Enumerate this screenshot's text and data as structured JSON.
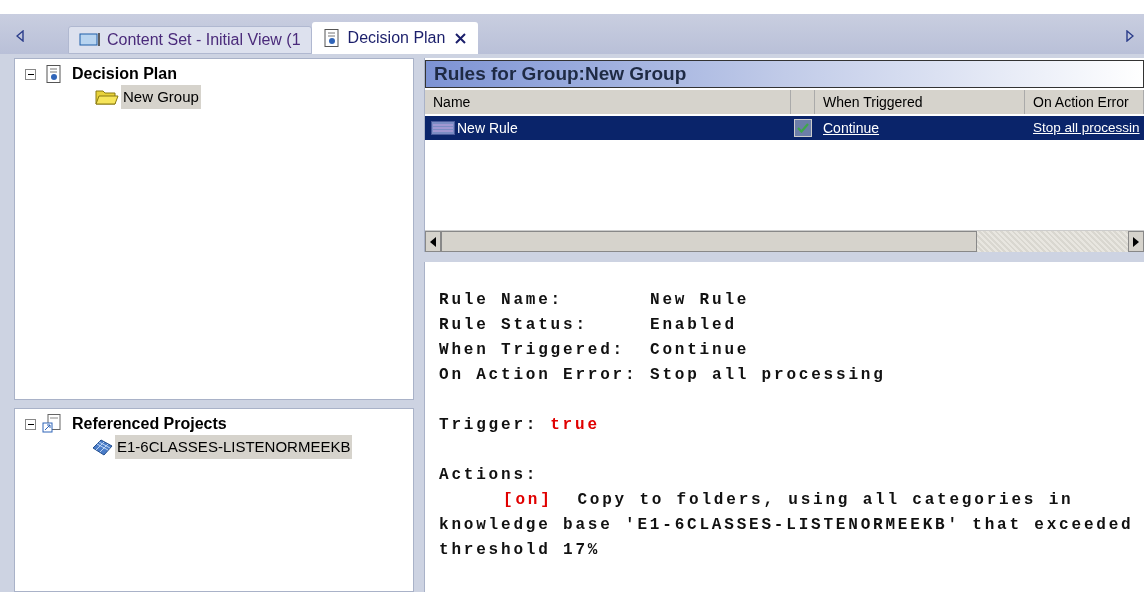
{
  "tabs": [
    {
      "label": "Content Set - Initial View (1",
      "selected": false,
      "closable": false
    },
    {
      "label": "Decision Plan",
      "selected": true,
      "closable": true
    }
  ],
  "plan_tree": {
    "label": "Decision Plan",
    "expanded": true,
    "children": [
      {
        "label": "New Group",
        "selected": true
      }
    ]
  },
  "projects_tree": {
    "label": "Referenced Projects",
    "expanded": true,
    "children": [
      {
        "label": "E1-6CLASSES-LISTENORMEEKB",
        "selected": true
      }
    ]
  },
  "rules": {
    "title": "Rules for Group:New Group",
    "columns": [
      "Name",
      "When Triggered",
      "On Action Error"
    ],
    "rows": [
      {
        "name": "New Rule",
        "enabled": true,
        "when_triggered": "Continue",
        "on_action_error": "Stop all processin",
        "selected": true
      }
    ],
    "scrollbar": {
      "level": 0.78
    }
  },
  "detail": {
    "fields": [
      {
        "label": "Rule Name:",
        "value": "New Rule"
      },
      {
        "label": "Rule Status:",
        "value": "Enabled"
      },
      {
        "label": "When Triggered:",
        "value": "Continue"
      },
      {
        "label": "On Action Error:",
        "value": "Stop all processing"
      }
    ],
    "trigger_label": "Trigger:",
    "trigger_value": "true",
    "actions_label": "Actions:",
    "actions": [
      {
        "state": "[on]",
        "text": "Copy to folders, using all categories in knowledge base 'E1-6CLASSES-LISTENORMEEKB' that exceeded threshold 17%"
      }
    ]
  }
}
